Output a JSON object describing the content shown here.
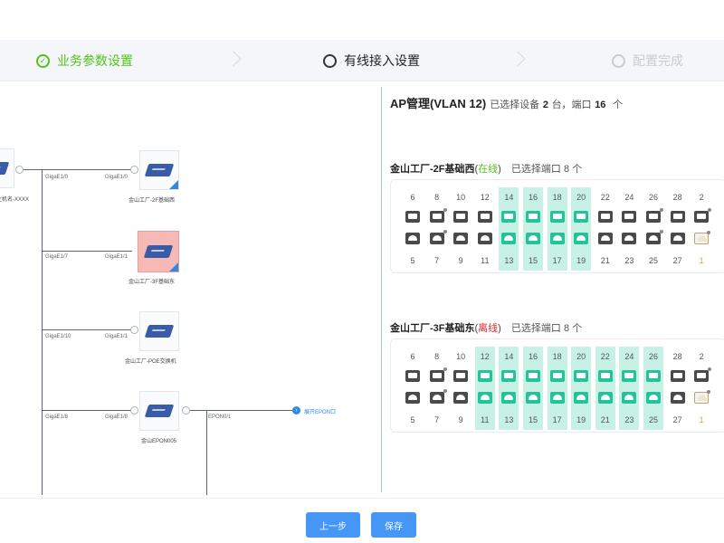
{
  "steps": [
    {
      "label": "业务参数设置",
      "state": "done"
    },
    {
      "label": "有线接入设置",
      "state": "active"
    },
    {
      "label": "配置完成",
      "state": "todo"
    }
  ],
  "topology": {
    "root_label": "主机名-XXXX",
    "root_port": "GigaE1/0",
    "devices": [
      {
        "label": "金山工厂-2F基础西",
        "port_left": "GigaE1/0",
        "port_right": "GigaE1/0",
        "selected": false
      },
      {
        "label": "金山工厂-3F基础东",
        "port_left": "GigaE1/7",
        "port_right": "GigaE1/1",
        "selected": true
      },
      {
        "label": "金山工厂-POE交换机",
        "port_left": "GigaE1/10",
        "port_right": "GigaE1/1",
        "selected": false
      },
      {
        "label": "金山EPON005",
        "port_left": "GigaE1/8",
        "port_right": "GigaE1/8",
        "selected": false
      }
    ],
    "epon_port": "EPON0/1",
    "link_text": "展开EPON口"
  },
  "right": {
    "title": "AP管理(VLAN 12)",
    "selected_prefix": "已选择设备",
    "device_count": "2",
    "device_unit": "台，端口",
    "port_count": "16",
    "port_unit": "个"
  },
  "switches": [
    {
      "name": "金山工厂-2F基础西",
      "status": "在线",
      "status_type": "online",
      "selected_text": "已选择端口 8 个",
      "top_numbers": [
        "6",
        "8",
        "10",
        "12",
        "14",
        "16",
        "18",
        "20",
        "22",
        "24",
        "26",
        "28",
        "2"
      ],
      "bottom_numbers": [
        "5",
        "7",
        "9",
        "11",
        "13",
        "15",
        "17",
        "19",
        "21",
        "23",
        "25",
        "27",
        "1"
      ],
      "highlighted": [
        4,
        5,
        6,
        7
      ]
    },
    {
      "name": "金山工厂-3F基础东",
      "status": "离线",
      "status_type": "offline",
      "selected_text": "已选择端口 8 个",
      "top_numbers": [
        "6",
        "8",
        "10",
        "12",
        "14",
        "16",
        "18",
        "20",
        "22",
        "24",
        "26",
        "28",
        "2"
      ],
      "bottom_numbers": [
        "5",
        "7",
        "9",
        "11",
        "13",
        "15",
        "17",
        "19",
        "21",
        "23",
        "25",
        "27",
        "1"
      ],
      "highlighted": [
        3,
        4,
        5,
        6,
        7,
        8,
        9,
        10
      ]
    }
  ],
  "footer": {
    "prev_label": "上一步",
    "save_label": "保存"
  },
  "colors": {
    "accent": "#4596f5",
    "online": "#52c41a",
    "offline": "#f5222d",
    "port_selected": "#22c39b",
    "port_highlight": "#c6f1e4"
  }
}
